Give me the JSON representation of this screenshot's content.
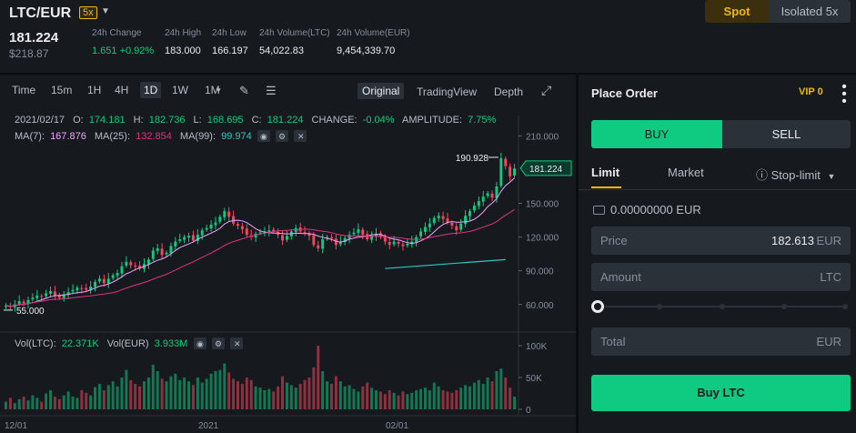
{
  "header": {
    "pair": "LTC/EUR",
    "leverage": "5x",
    "last_price": "181.224",
    "fiat_price": "$218.87",
    "stats": [
      {
        "label": "24h Change",
        "value": "1.651 +0.92%",
        "color": "#0ecb81"
      },
      {
        "label": "24h High",
        "value": "183.000",
        "color": "#eaecef"
      },
      {
        "label": "24h Low",
        "value": "166.197",
        "color": "#eaecef"
      },
      {
        "label": "24h Volume(LTC)",
        "value": "54,022.83",
        "color": "#eaecef"
      },
      {
        "label": "24h Volume(EUR)",
        "value": "9,454,339.70",
        "color": "#eaecef"
      }
    ],
    "modes": {
      "spot": "Spot",
      "isolated": "Isolated 5x"
    }
  },
  "toolbar": {
    "timeframes": [
      "Time",
      "15m",
      "1H",
      "4H",
      "1D",
      "1W",
      "1M"
    ],
    "active_timeframe": "1D",
    "views": [
      "Original",
      "TradingView",
      "Depth"
    ],
    "active_view": "Original"
  },
  "legend": {
    "ohlc_text": "2021/02/17  O: 174.181  H: 182.736  L: 168.695  C: 181.224  CHANGE: -0.04%  AMPLITUDE: 7.75%",
    "date": "2021/02/17",
    "o_label": "O:",
    "o": "174.181",
    "h_label": "H:",
    "h": "182.736",
    "l_label": "L:",
    "l": "168.695",
    "c_label": "C:",
    "c": "181.224",
    "change_label": "CHANGE:",
    "change": "-0.04%",
    "amp_label": "AMPLITUDE:",
    "amp": "7.75%",
    "ma7_label": "MA(7):",
    "ma7": "167.876",
    "ma25_label": "MA(25):",
    "ma25": "132.854",
    "ma99_label": "MA(99):",
    "ma99": "99.974",
    "vol_ltc_label": "Vol(LTC):",
    "vol_ltc": "22.371K",
    "vol_eur_label": "Vol(EUR)",
    "vol_eur": "3.933M"
  },
  "chart_data": {
    "type": "candlestick",
    "price_axis_ticks": [
      "210.000",
      "150.000",
      "120.000",
      "90.000",
      "60.000"
    ],
    "volume_axis_ticks": [
      "100K",
      "50K",
      "0"
    ],
    "x_tick_labels": [
      "12/01",
      "2021",
      "02/01"
    ],
    "ylim": [
      42,
      220
    ],
    "current_price_label": "181.224",
    "high_marker": "190.928",
    "low_marker": "55.000",
    "colors": {
      "up": "#0ecb81",
      "down": "#f6465d",
      "ma7": "#f0a0ff",
      "ma25": "#e0327e",
      "ma99": "#2fc6c6"
    },
    "candles_close": [
      59,
      58,
      60,
      63,
      61,
      64,
      66,
      68,
      67,
      70,
      72,
      68,
      66,
      69,
      71,
      73,
      75,
      74,
      73,
      76,
      80,
      83,
      79,
      83,
      86,
      88,
      94,
      98,
      95,
      94,
      92,
      96,
      100,
      108,
      110,
      104,
      106,
      112,
      116,
      118,
      120,
      121,
      117,
      122,
      126,
      128,
      131,
      133,
      138,
      143,
      138,
      132,
      130,
      127,
      122,
      120,
      123,
      124,
      125,
      126,
      125,
      122,
      117,
      121,
      125,
      128,
      125,
      124,
      121,
      113,
      110,
      118,
      120,
      119,
      113,
      116,
      119,
      122,
      124,
      127,
      122,
      118,
      121,
      123,
      120,
      116,
      113,
      116,
      114,
      112,
      114,
      116,
      120,
      125,
      129,
      132,
      137,
      139,
      136,
      133,
      130,
      126,
      132,
      139,
      143,
      148,
      152,
      156,
      159,
      155,
      165,
      190,
      183,
      174,
      181
    ],
    "volume_relative": [
      0.12,
      0.18,
      0.1,
      0.16,
      0.2,
      0.14,
      0.22,
      0.18,
      0.12,
      0.25,
      0.3,
      0.2,
      0.16,
      0.22,
      0.28,
      0.2,
      0.18,
      0.3,
      0.26,
      0.22,
      0.35,
      0.4,
      0.3,
      0.38,
      0.44,
      0.36,
      0.5,
      0.62,
      0.46,
      0.4,
      0.36,
      0.44,
      0.5,
      0.7,
      0.6,
      0.48,
      0.44,
      0.52,
      0.56,
      0.46,
      0.5,
      0.44,
      0.38,
      0.5,
      0.42,
      0.48,
      0.56,
      0.6,
      0.62,
      0.72,
      0.58,
      0.48,
      0.44,
      0.4,
      0.5,
      0.46,
      0.36,
      0.34,
      0.3,
      0.32,
      0.28,
      0.36,
      0.52,
      0.42,
      0.38,
      0.34,
      0.4,
      0.46,
      0.5,
      0.66,
      1.0,
      0.6,
      0.44,
      0.4,
      0.52,
      0.44,
      0.36,
      0.38,
      0.32,
      0.28,
      0.36,
      0.42,
      0.34,
      0.3,
      0.28,
      0.24,
      0.3,
      0.26,
      0.22,
      0.28,
      0.24,
      0.26,
      0.3,
      0.32,
      0.34,
      0.3,
      0.42,
      0.36,
      0.3,
      0.28,
      0.26,
      0.3,
      0.34,
      0.38,
      0.36,
      0.42,
      0.46,
      0.4,
      0.5,
      0.44,
      0.6,
      0.64,
      0.5,
      0.34,
      0.2
    ]
  },
  "order": {
    "title": "Place Order",
    "vip": "VIP 0",
    "buy_tab": "BUY",
    "sell_tab": "SELL",
    "types": [
      "Limit",
      "Market",
      "Stop-limit"
    ],
    "balance": "0.00000000 EUR",
    "price_label": "Price",
    "price_value": "182.613",
    "price_unit": "EUR",
    "amount_label": "Amount",
    "amount_unit": "LTC",
    "total_label": "Total",
    "total_unit": "EUR",
    "slider_percent": 0,
    "buy_button": "Buy LTC"
  }
}
